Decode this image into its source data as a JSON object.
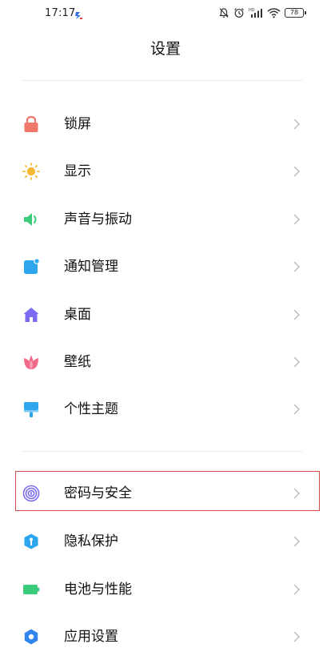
{
  "status_bar": {
    "time": "17:17",
    "battery_level": "78"
  },
  "header": {
    "title": "设置"
  },
  "menu": {
    "group1": [
      {
        "label": "锁屏",
        "icon": "lock-icon",
        "color": "#F0776A"
      },
      {
        "label": "显示",
        "icon": "sun-icon",
        "color": "#F5B935"
      },
      {
        "label": "声音与振动",
        "icon": "speaker-icon",
        "color": "#3CCB7A"
      },
      {
        "label": "通知管理",
        "icon": "notification-icon",
        "color": "#2EA6EE"
      },
      {
        "label": "桌面",
        "icon": "home-icon",
        "color": "#7B6CF2"
      },
      {
        "label": "壁纸",
        "icon": "tulip-icon",
        "color": "#F26A8A"
      },
      {
        "label": "个性主题",
        "icon": "brush-icon",
        "color": "#2EA6EE"
      }
    ],
    "group2": [
      {
        "label": "密码与安全",
        "icon": "fingerprint-icon",
        "color": "#7B6CF2",
        "highlighted": true
      },
      {
        "label": "隐私保护",
        "icon": "privacy-shield-icon",
        "color": "#2EA6EE"
      },
      {
        "label": "电池与性能",
        "icon": "battery-icon",
        "color": "#3CCB7A"
      },
      {
        "label": "应用设置",
        "icon": "gear-icon",
        "color": "#2E86EE"
      }
    ]
  },
  "colors": {
    "highlight_border": "#D24A4A",
    "chevron": "#BDBDBD"
  }
}
